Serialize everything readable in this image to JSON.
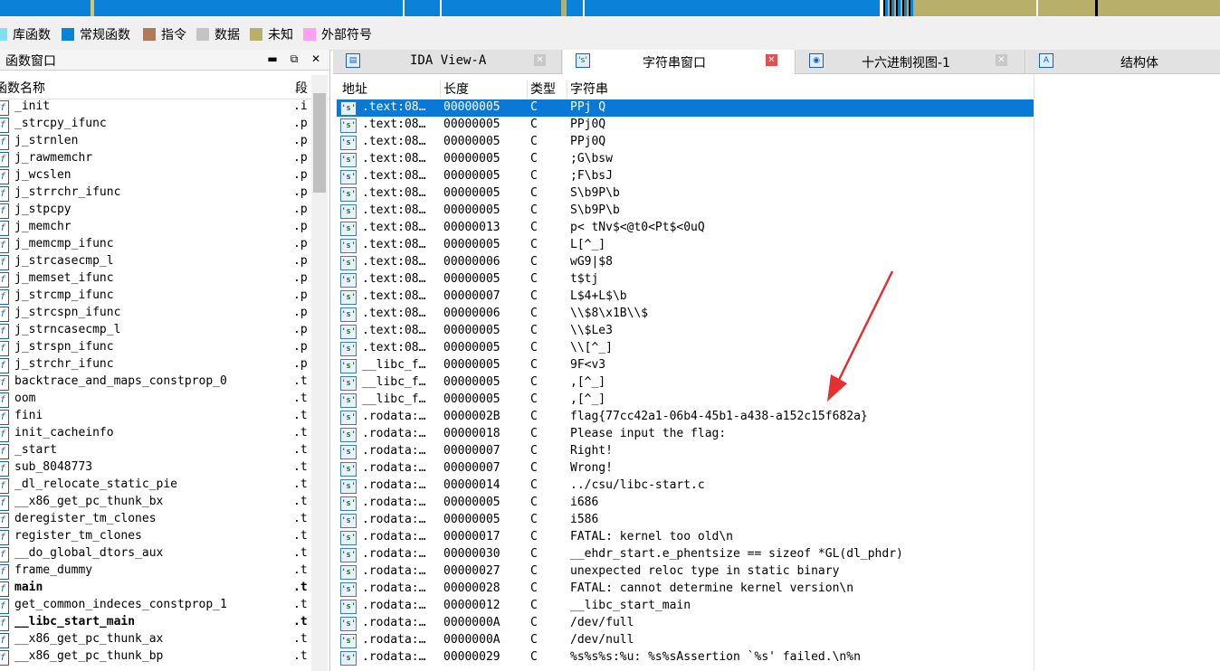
{
  "colors": {
    "library_function": "#7fe0f0",
    "regular_function": "#0a82d8",
    "instruction": "#b07a5a",
    "data": "#c4c4c4",
    "unexplored": "#b8b06a",
    "external_symbol": "#ffa0f0",
    "selection": "#0a78d7",
    "annotation_arrow": "#e53030"
  },
  "legend": [
    {
      "label": "库函数",
      "color": "#7fe0f0"
    },
    {
      "label": "常规函数",
      "color": "#0a82d8"
    },
    {
      "label": "指令",
      "color": "#b07a5a"
    },
    {
      "label": "数据",
      "color": "#c4c4c4"
    },
    {
      "label": "未知",
      "color": "#b8b06a"
    },
    {
      "label": "外部符号",
      "color": "#ffa0f0"
    }
  ],
  "functions_window": {
    "title": "函数窗口",
    "col_name": "函数名称",
    "col_segment": "段",
    "rows": [
      {
        "name": "_init",
        "segment": ".i",
        "bold": false
      },
      {
        "name": "_strcpy_ifunc",
        "segment": ".p",
        "bold": false
      },
      {
        "name": "j_strnlen",
        "segment": ".p",
        "bold": false
      },
      {
        "name": "j_rawmemchr",
        "segment": ".p",
        "bold": false
      },
      {
        "name": "j_wcslen",
        "segment": ".p",
        "bold": false
      },
      {
        "name": "j_strrchr_ifunc",
        "segment": ".p",
        "bold": false
      },
      {
        "name": "j_stpcpy",
        "segment": ".p",
        "bold": false
      },
      {
        "name": "j_memchr",
        "segment": ".p",
        "bold": false
      },
      {
        "name": "j_memcmp_ifunc",
        "segment": ".p",
        "bold": false
      },
      {
        "name": "j_strcasecmp_l",
        "segment": ".p",
        "bold": false
      },
      {
        "name": "j_memset_ifunc",
        "segment": ".p",
        "bold": false
      },
      {
        "name": "j_strcmp_ifunc",
        "segment": ".p",
        "bold": false
      },
      {
        "name": "j_strcspn_ifunc",
        "segment": ".p",
        "bold": false
      },
      {
        "name": "j_strncasecmp_l",
        "segment": ".p",
        "bold": false
      },
      {
        "name": "j_strspn_ifunc",
        "segment": ".p",
        "bold": false
      },
      {
        "name": "j_strchr_ifunc",
        "segment": ".p",
        "bold": false
      },
      {
        "name": "backtrace_and_maps_constprop_0",
        "segment": ".t",
        "bold": false
      },
      {
        "name": "oom",
        "segment": ".t",
        "bold": false
      },
      {
        "name": "fini",
        "segment": ".t",
        "bold": false
      },
      {
        "name": "init_cacheinfo",
        "segment": ".t",
        "bold": false
      },
      {
        "name": "_start",
        "segment": ".t",
        "bold": false
      },
      {
        "name": "sub_8048773",
        "segment": ".t",
        "bold": false
      },
      {
        "name": "_dl_relocate_static_pie",
        "segment": ".t",
        "bold": false
      },
      {
        "name": "__x86_get_pc_thunk_bx",
        "segment": ".t",
        "bold": false
      },
      {
        "name": "deregister_tm_clones",
        "segment": ".t",
        "bold": false
      },
      {
        "name": "register_tm_clones",
        "segment": ".t",
        "bold": false
      },
      {
        "name": "__do_global_dtors_aux",
        "segment": ".t",
        "bold": false
      },
      {
        "name": "frame_dummy",
        "segment": ".t",
        "bold": false
      },
      {
        "name": "main",
        "segment": ".t",
        "bold": true
      },
      {
        "name": "get_common_indeces_constprop_1",
        "segment": ".t",
        "bold": false
      },
      {
        "name": "__libc_start_main",
        "segment": ".t",
        "bold": true
      },
      {
        "name": "__x86_get_pc_thunk_ax",
        "segment": ".t",
        "bold": false
      },
      {
        "name": "__x86_get_pc_thunk_bp",
        "segment": ".t",
        "bold": false
      }
    ]
  },
  "tabs": [
    {
      "label": "IDA View-A",
      "icon": "ida-view-icon",
      "active": false
    },
    {
      "label": "字符串窗口",
      "icon": "strings-icon",
      "active": true
    },
    {
      "label": "十六进制视图-1",
      "icon": "hex-view-icon",
      "active": false
    },
    {
      "label": "结构体",
      "icon": "structures-icon",
      "active": false
    }
  ],
  "strings_window": {
    "columns": {
      "address": "地址",
      "length": "长度",
      "type": "类型",
      "string": "字符串"
    },
    "rows": [
      {
        "address": ".text:08…",
        "length": "00000005",
        "type": "C",
        "string": "PPj Q",
        "selected": true
      },
      {
        "address": ".text:08…",
        "length": "00000005",
        "type": "C",
        "string": "PPj0Q"
      },
      {
        "address": ".text:08…",
        "length": "00000005",
        "type": "C",
        "string": "PPj0Q"
      },
      {
        "address": ".text:08…",
        "length": "00000005",
        "type": "C",
        "string": ";G\\bsw"
      },
      {
        "address": ".text:08…",
        "length": "00000005",
        "type": "C",
        "string": ";F\\bsJ"
      },
      {
        "address": ".text:08…",
        "length": "00000005",
        "type": "C",
        "string": "S\\b9P\\b"
      },
      {
        "address": ".text:08…",
        "length": "00000005",
        "type": "C",
        "string": "S\\b9P\\b"
      },
      {
        "address": ".text:08…",
        "length": "00000013",
        "type": "C",
        "string": "p< tNv$<@t0<Pt$<0uQ"
      },
      {
        "address": ".text:08…",
        "length": "00000005",
        "type": "C",
        "string": "L[^_]"
      },
      {
        "address": ".text:08…",
        "length": "00000006",
        "type": "C",
        "string": "wG9|$8"
      },
      {
        "address": ".text:08…",
        "length": "00000005",
        "type": "C",
        "string": "t$tj"
      },
      {
        "address": ".text:08…",
        "length": "00000007",
        "type": "C",
        "string": "L$4+L$\\b"
      },
      {
        "address": ".text:08…",
        "length": "00000006",
        "type": "C",
        "string": "\\\\$8\\x1B\\\\$"
      },
      {
        "address": ".text:08…",
        "length": "00000005",
        "type": "C",
        "string": "\\\\$Le3"
      },
      {
        "address": ".text:08…",
        "length": "00000005",
        "type": "C",
        "string": "\\\\[^_]"
      },
      {
        "address": "__libc_f…",
        "length": "00000005",
        "type": "C",
        "string": "9F<v3"
      },
      {
        "address": "__libc_f…",
        "length": "00000005",
        "type": "C",
        "string": ",[^_]"
      },
      {
        "address": "__libc_f…",
        "length": "00000005",
        "type": "C",
        "string": ",[^_]"
      },
      {
        "address": ".rodata:…",
        "length": "0000002B",
        "type": "C",
        "string": "flag{77cc42a1-06b4-45b1-a438-a152c15f682a}"
      },
      {
        "address": ".rodata:…",
        "length": "00000018",
        "type": "C",
        "string": "Please input the flag:"
      },
      {
        "address": ".rodata:…",
        "length": "00000007",
        "type": "C",
        "string": "Right!"
      },
      {
        "address": ".rodata:…",
        "length": "00000007",
        "type": "C",
        "string": "Wrong!"
      },
      {
        "address": ".rodata:…",
        "length": "00000014",
        "type": "C",
        "string": "../csu/libc-start.c"
      },
      {
        "address": ".rodata:…",
        "length": "00000005",
        "type": "C",
        "string": "i686"
      },
      {
        "address": ".rodata:…",
        "length": "00000005",
        "type": "C",
        "string": "i586"
      },
      {
        "address": ".rodata:…",
        "length": "00000017",
        "type": "C",
        "string": "FATAL: kernel too old\\n"
      },
      {
        "address": ".rodata:…",
        "length": "00000030",
        "type": "C",
        "string": "__ehdr_start.e_phentsize == sizeof *GL(dl_phdr)"
      },
      {
        "address": ".rodata:…",
        "length": "00000027",
        "type": "C",
        "string": "unexpected reloc type in static binary"
      },
      {
        "address": ".rodata:…",
        "length": "00000028",
        "type": "C",
        "string": "FATAL: cannot determine kernel version\\n"
      },
      {
        "address": ".rodata:…",
        "length": "00000012",
        "type": "C",
        "string": "__libc_start_main"
      },
      {
        "address": ".rodata:…",
        "length": "0000000A",
        "type": "C",
        "string": "/dev/full"
      },
      {
        "address": ".rodata:…",
        "length": "0000000A",
        "type": "C",
        "string": "/dev/null"
      },
      {
        "address": ".rodata:…",
        "length": "00000029",
        "type": "C",
        "string": "%s%s%s:%u: %s%sAssertion `%s' failed.\\n%n"
      }
    ]
  }
}
